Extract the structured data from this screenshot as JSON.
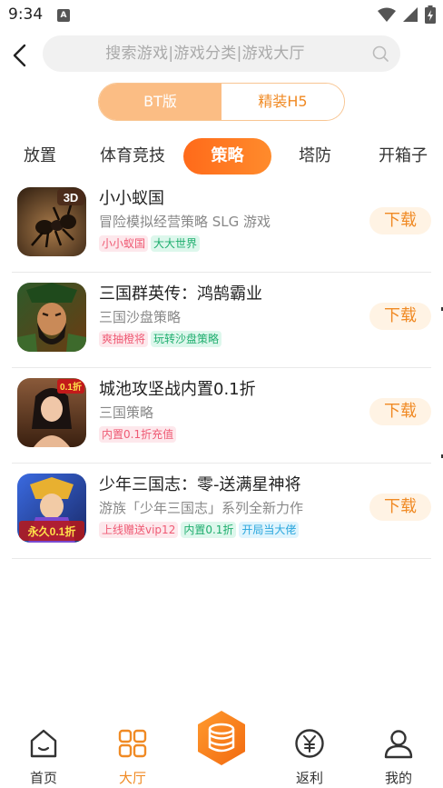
{
  "status_bar": {
    "time": "9:34",
    "notification_letter": "A"
  },
  "search": {
    "placeholder": "搜索游戏|游戏分类|游戏大厅"
  },
  "toggle": {
    "options": [
      "BT版",
      "精装H5"
    ],
    "active_index": 0
  },
  "tabs": {
    "items": [
      "放置",
      "体育竞技",
      "策略",
      "塔防",
      "开箱子"
    ],
    "active_index": 2
  },
  "games": [
    {
      "name": "小小蚁国",
      "desc": "冒险模拟经营策略 SLG 游戏",
      "badge": "3D",
      "tags": [
        {
          "text": "小小蚁国",
          "style": "pink"
        },
        {
          "text": "大大世界",
          "style": "green"
        }
      ],
      "download_label": "下载"
    },
    {
      "name": "三国群英传：鸿鹄霸业",
      "desc": "三国沙盘策略",
      "tags": [
        {
          "text": "爽抽橙将",
          "style": "pink"
        },
        {
          "text": "玩转沙盘策略",
          "style": "green"
        }
      ],
      "download_label": "下载"
    },
    {
      "name": "城池攻坚战内置0.1折",
      "desc": "三国策略",
      "badge": "0.1折",
      "tags": [
        {
          "text": "内置0.1折充值",
          "style": "pink"
        }
      ],
      "download_label": "下载"
    },
    {
      "name": "少年三国志：零-送满星神将",
      "desc": "游族「少年三国志」系列全新力作",
      "badge": "永久0.1折",
      "tags": [
        {
          "text": "上线赠送vip12",
          "style": "pink"
        },
        {
          "text": "内置0.1折",
          "style": "green"
        },
        {
          "text": "开局当大佬",
          "style": "blue"
        }
      ],
      "download_label": "下载"
    }
  ],
  "bottom_nav": {
    "items": [
      {
        "label": "首页",
        "icon": "home-icon"
      },
      {
        "label": "大厅",
        "icon": "grid-icon"
      },
      {
        "label": "",
        "icon": "coin-stack-icon"
      },
      {
        "label": "返利",
        "icon": "yen-icon"
      },
      {
        "label": "我的",
        "icon": "user-icon"
      }
    ],
    "active_index": 1
  },
  "colors": {
    "accent": "#f08a24",
    "accent_light": "#fbbd84",
    "tab_active": "#ff6a1a",
    "download_bg": "#fff3e4"
  }
}
